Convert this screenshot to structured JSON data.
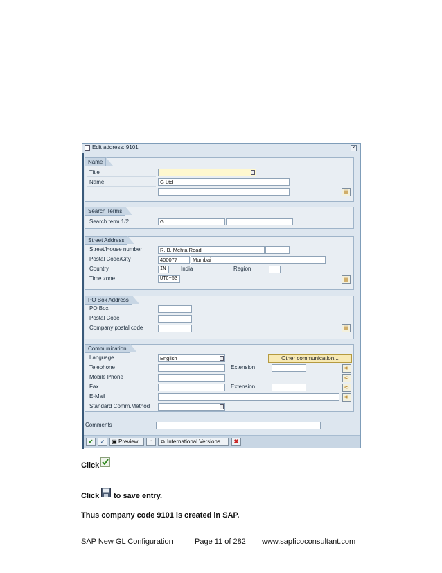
{
  "dialog": {
    "title": "Edit address: 9101",
    "groups": {
      "name": {
        "title": "Name",
        "title_label": "Title",
        "title_value": "",
        "name_label": "Name",
        "name_value": "G Ltd",
        "name2_value": ""
      },
      "search": {
        "title": "Search Terms",
        "term_label": "Search term 1/2",
        "term1_value": "G",
        "term2_value": ""
      },
      "street": {
        "title": "Street Address",
        "street_label": "Street/House number",
        "street_value": "R. B. Mehta Road",
        "house_value": "",
        "postal_label": "Postal Code/City",
        "postal_value": "400077",
        "city_value": "Mumbai",
        "country_label": "Country",
        "country_value": "IN",
        "country_name": "India",
        "region_label": "Region",
        "region_value": "",
        "timezone_label": "Time zone",
        "timezone_value": "UTC+53"
      },
      "pobox": {
        "title": "PO Box Address",
        "pobox_label": "PO Box",
        "pobox_value": "",
        "postal_label": "Postal Code",
        "postal_value": "",
        "company_label": "Company postal code",
        "company_value": ""
      },
      "communication": {
        "title": "Communication",
        "language_label": "Language",
        "language_value": "English",
        "other_button": "Other communication...",
        "telephone_label": "Telephone",
        "telephone_value": "",
        "extension_label": "Extension",
        "extension_value": "",
        "mobile_label": "Mobile Phone",
        "mobile_value": "",
        "fax_label": "Fax",
        "fax_value": "",
        "fax_extension_label": "Extension",
        "fax_extension_value": "",
        "email_label": "E-Mail",
        "email_value": "",
        "std_method_label": "Standard Comm.Method",
        "std_method_value": ""
      }
    },
    "comments_label": "Comments",
    "comments_value": "",
    "toolbar": {
      "preview_label": "Preview",
      "intl_label": "International Versions"
    }
  },
  "page": {
    "click1": "Click",
    "click2": "Click",
    "save_text": "to save entry.",
    "result_text": "Thus company code 9101 is created in SAP.",
    "footer_left": "SAP New GL Configuration",
    "footer_mid": "Page 11 of 282",
    "footer_right": "www.sapficoconsultant.com"
  },
  "colors": {
    "dialog_bg": "#dde6ef",
    "group_header": "#c8d6e4",
    "required_field": "#fff8cf",
    "accent_button": "#f7e9b4"
  }
}
